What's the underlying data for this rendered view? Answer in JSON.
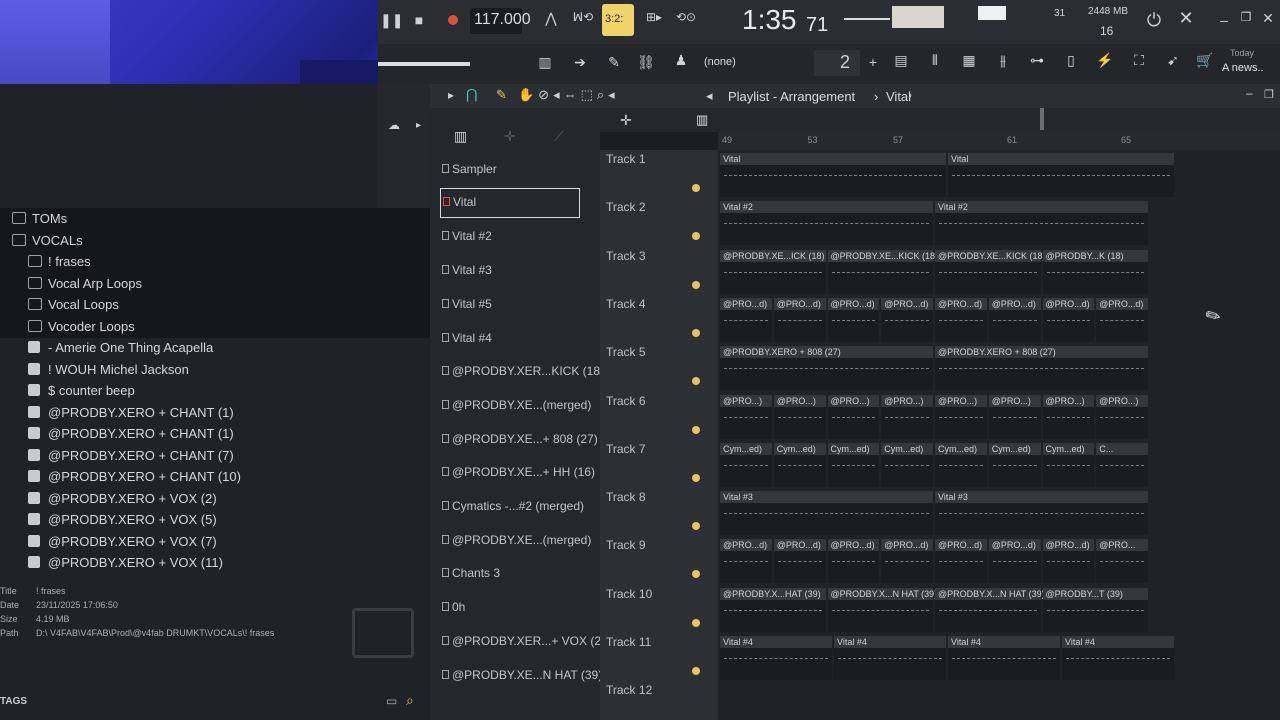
{
  "toolbar": {
    "tempo": "117.000",
    "time_main": "1:35",
    "time_sub": "71",
    "beat_readout": "3:2:",
    "memory": "2448 MB",
    "cpu_count": "16",
    "cpu_extra": "31",
    "pattern_none": "(none)",
    "snap_value": "2",
    "hint_title": "Today",
    "hint_text": "A news.."
  },
  "playlist_header": {
    "title": "Playlist - Arrangement",
    "separator": "›",
    "pattern": "Vital"
  },
  "ruler": [
    "49",
    "",
    "",
    "53",
    "",
    "",
    "57",
    "",
    "",
    "",
    "61",
    "",
    "",
    "",
    "65",
    "",
    "",
    "",
    ""
  ],
  "browser": {
    "items": [
      {
        "label": "TOMs",
        "kind": "folder"
      },
      {
        "label": "VOCALs",
        "kind": "folder"
      },
      {
        "label": "! frases",
        "kind": "subfolder"
      },
      {
        "label": "Vocal Arp Loops",
        "kind": "subfolder"
      },
      {
        "label": "Vocal Loops",
        "kind": "subfolder"
      },
      {
        "label": "Vocoder Loops",
        "kind": "subfolder"
      },
      {
        "label": "- Amerie One Thing Acapella",
        "kind": "file"
      },
      {
        "label": "! WOUH Michel Jackson",
        "kind": "file"
      },
      {
        "label": "$ counter beep",
        "kind": "file"
      },
      {
        "label": "@PRODBY.XERO + CHANT (1)",
        "kind": "file"
      },
      {
        "label": "@PRODBY.XERO + CHANT (1)",
        "kind": "file"
      },
      {
        "label": "@PRODBY.XERO + CHANT (7)",
        "kind": "file"
      },
      {
        "label": "@PRODBY.XERO + CHANT (10)",
        "kind": "file"
      },
      {
        "label": "@PRODBY.XERO + VOX (2)",
        "kind": "file"
      },
      {
        "label": "@PRODBY.XERO + VOX (5)",
        "kind": "file"
      },
      {
        "label": "@PRODBY.XERO + VOX (7)",
        "kind": "file"
      },
      {
        "label": "@PRODBY.XERO + VOX (11)",
        "kind": "file"
      }
    ],
    "info": {
      "title_label": "Title",
      "title_value": "! frases",
      "date_label": "Date",
      "date_value": "23/11/2025 17:06:50",
      "size_label": "Size",
      "size_value": "4.19 MB",
      "path_label": "Path",
      "path_value": "D:\\ V4FAB\\V4FAB\\Prod\\@v4fab DRUMKT\\VOCALs\\! frases"
    },
    "tags_label": "TAGS"
  },
  "channels": [
    "Sampler",
    "Vital",
    "Vital #2",
    "Vital #3",
    "Vital #5",
    "Vital #4",
    "@PRODBY.XER...KICK (18)",
    "@PRODBY.XE...(merged)",
    "@PRODBY.XE...+ 808 (27)",
    "@PRODBY.XE...+ HH (16)",
    "Cymatics -...#2 (merged)",
    "@PRODBY.XE...(merged)",
    "Chants 3",
    "0h",
    "@PRODBY.XER...+ VOX (2)",
    "@PRODBY.XE...N HAT (39)"
  ],
  "tracks": [
    {
      "name": "Track 1",
      "clips": [
        "Vital",
        "Vital"
      ]
    },
    {
      "name": "Track 2",
      "clips": [
        "Vital #2",
        "Vital #2"
      ]
    },
    {
      "name": "Track 3",
      "clips": [
        "@PRODBY.XE...ICK (18)",
        "@PRODBY.XE...KICK (18)",
        "@PRODBY.XE...KICK (18)",
        "@PRODBY...K (18)"
      ]
    },
    {
      "name": "Track 4",
      "clips": [
        "@PRO...d)",
        "@PRO...d)",
        "@PRO...d)",
        "@PRO...d)",
        "@PRO...d)",
        "@PRO...d)",
        "@PRO...d)",
        "@PRO...d)"
      ]
    },
    {
      "name": "Track 5",
      "clips": [
        "@PRODBY.XERO + 808 (27)",
        "@PRODBY.XERO + 808 (27)"
      ]
    },
    {
      "name": "Track 6",
      "clips": [
        "@PRO...)",
        "@PRO...)",
        "@PRO...)",
        "@PRO...)",
        "@PRO...)",
        "@PRO...)",
        "@PRO...)",
        "@PRO...)"
      ]
    },
    {
      "name": "Track 7",
      "clips": [
        "Cym...ed)",
        "Cym...ed)",
        "Cym...ed)",
        "Cym...ed)",
        "Cym...ed)",
        "Cym...ed)",
        "Cym...ed)",
        "C..."
      ]
    },
    {
      "name": "Track 8",
      "clips": [
        "Vital #3",
        "Vital #3"
      ]
    },
    {
      "name": "Track 9",
      "clips": [
        "@PRO...d)",
        "@PRO...d)",
        "@PRO...d)",
        "@PRO...d)",
        "@PRO...d)",
        "@PRO...d)",
        "@PRO...d)",
        "@PRO..."
      ]
    },
    {
      "name": "Track 10",
      "clips": [
        "@PRODBY.X...HAT (39)",
        "@PRODBY.X...N HAT (39)",
        "@PRODBY.X...N HAT (39)",
        "@PRODBY...T (39)"
      ]
    },
    {
      "name": "Track 11",
      "clips": [
        "Vital #4",
        "Vital #4",
        "Vital #4",
        "Vital #4"
      ]
    },
    {
      "name": "Track 12",
      "clips": []
    }
  ],
  "colors": {
    "accent": "#e8c25a",
    "record": "#e0503c",
    "bg": "#1b1d20"
  }
}
